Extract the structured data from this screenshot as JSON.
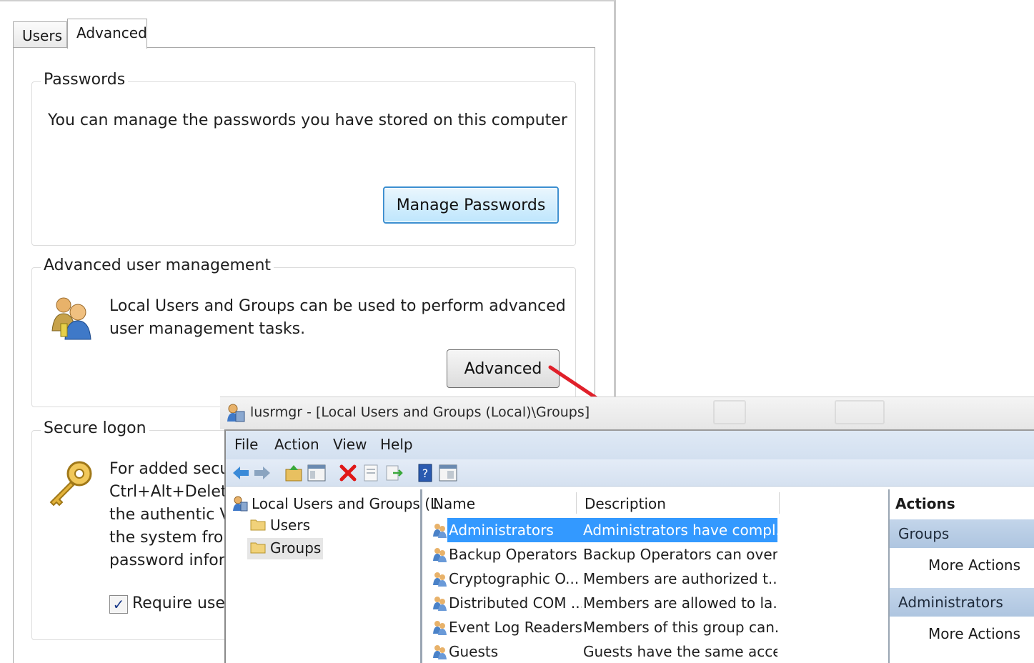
{
  "dialog": {
    "tabs": [
      {
        "label": "Users"
      },
      {
        "label": "Advanced"
      }
    ],
    "passwords": {
      "title": "Passwords",
      "text": "You can manage the passwords you have stored on this computer",
      "button": "Manage Passwords"
    },
    "aum": {
      "title": "Advanced user management",
      "text_line1": "Local Users and Groups can be used to perform advanced",
      "text_line2": "user management tasks.",
      "button": "Advanced"
    },
    "logon": {
      "title": "Secure logon",
      "lines": [
        "For added secu",
        "Ctrl+Alt+Delet",
        "the authentic V",
        "the system fror",
        "password infor"
      ],
      "checkbox_label": "Require use",
      "checked": true
    }
  },
  "mmc": {
    "title": "lusrmgr - [Local Users and Groups (Local)\\Groups]",
    "menu": [
      "File",
      "Action",
      "View",
      "Help"
    ],
    "toolbar": [
      "back-icon",
      "forward-icon",
      "up-folder-icon",
      "show-hide-tree-icon",
      "delete-icon",
      "properties-icon",
      "export-list-icon",
      "help-icon",
      "console-view-icon"
    ],
    "tree": {
      "root": "Local Users and Groups (L",
      "children": [
        "Users",
        "Groups"
      ]
    },
    "columns": {
      "name": "Name",
      "description": "Description"
    },
    "rows": [
      {
        "name": "Administrators",
        "desc": "Administrators have compl..."
      },
      {
        "name": "Backup Operators",
        "desc": "Backup Operators can over..."
      },
      {
        "name": "Cryptographic O...",
        "desc": "Members are authorized t..."
      },
      {
        "name": "Distributed COM ...",
        "desc": "Members are allowed to la..."
      },
      {
        "name": "Event Log Readers",
        "desc": "Members of this group can..."
      },
      {
        "name": "Guests",
        "desc": "Guests have the same acce..."
      }
    ],
    "selected_row": 0,
    "actions": {
      "title": "Actions",
      "sections": [
        {
          "header": "Groups",
          "link": "More Actions"
        },
        {
          "header": "Administrators",
          "link": "More Actions"
        }
      ]
    }
  },
  "colors": {
    "selection": "#3399ff",
    "arrow": "#e0202a",
    "button_focus": "#3c8fd0"
  }
}
